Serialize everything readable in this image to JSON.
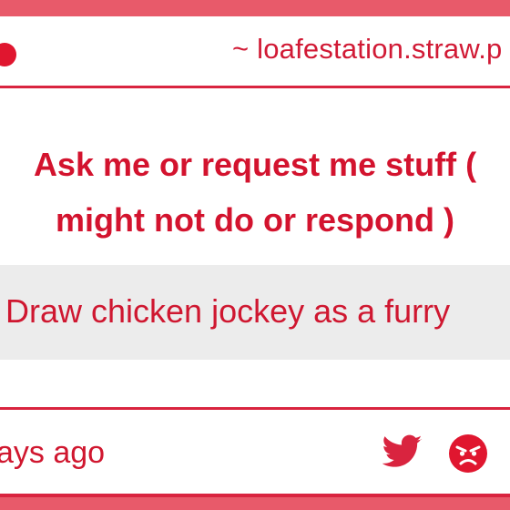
{
  "header": {
    "url": "~ loafestation.straw.p"
  },
  "question": {
    "line1": "Ask me or request me stuff (",
    "line2": "might not do or respond )"
  },
  "prompt": {
    "text": "Draw chicken jockey as a furry"
  },
  "footer": {
    "time": "ays ago",
    "icons": [
      "twitter-icon",
      "angry-face-icon"
    ]
  },
  "colors": {
    "accent": "#d3132e",
    "band": "#e85a6a",
    "prompt_bg": "#ececec"
  }
}
